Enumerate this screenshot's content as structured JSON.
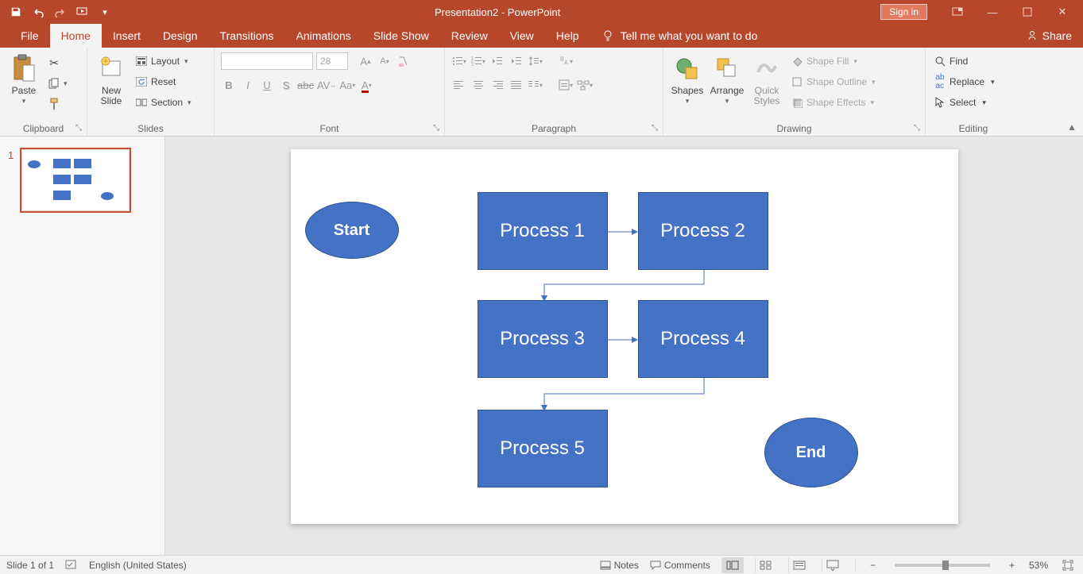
{
  "titlebar": {
    "title": "Presentation2  -  PowerPoint",
    "signin": "Sign in"
  },
  "tabs": {
    "file": "File",
    "home": "Home",
    "insert": "Insert",
    "design": "Design",
    "transitions": "Transitions",
    "animations": "Animations",
    "slideshow": "Slide Show",
    "review": "Review",
    "view": "View",
    "help": "Help",
    "tellme": "Tell me what you want to do",
    "share": "Share"
  },
  "ribbon": {
    "clipboard": {
      "label": "Clipboard",
      "paste": "Paste"
    },
    "slides": {
      "label": "Slides",
      "newslide": "New\nSlide",
      "layout": "Layout",
      "reset": "Reset",
      "section": "Section"
    },
    "font": {
      "label": "Font",
      "size": "28"
    },
    "paragraph": {
      "label": "Paragraph"
    },
    "drawing": {
      "label": "Drawing",
      "shapes": "Shapes",
      "arrange": "Arrange",
      "quick": "Quick\nStyles",
      "fill": "Shape Fill",
      "outline": "Shape Outline",
      "effects": "Shape Effects"
    },
    "editing": {
      "label": "Editing",
      "find": "Find",
      "replace": "Replace",
      "select": "Select"
    }
  },
  "thumb": {
    "num": "1"
  },
  "slide": {
    "start": "Start",
    "end": "End",
    "p1": "Process 1",
    "p2": "Process 2",
    "p3": "Process 3",
    "p4": "Process 4",
    "p5": "Process 5"
  },
  "status": {
    "slide": "Slide 1 of 1",
    "lang": "English (United States)",
    "notes": "Notes",
    "comments": "Comments",
    "zoom": "53%"
  }
}
